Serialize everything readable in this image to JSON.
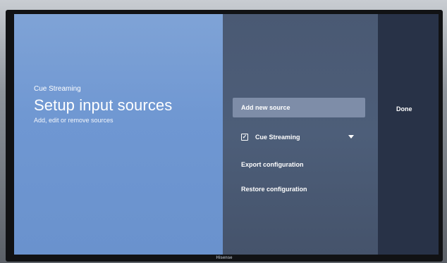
{
  "header": {
    "app_name": "Cue Streaming",
    "title": "Setup input sources",
    "description": "Add, edit or remove sources"
  },
  "menu": {
    "items": [
      {
        "label": "Add new source",
        "focused": true
      },
      {
        "label": "Cue Streaming",
        "checked": true,
        "expandable": true
      },
      {
        "label": "Export configuration"
      },
      {
        "label": "Restore configuration"
      }
    ]
  },
  "actions": {
    "done_label": "Done"
  },
  "tv": {
    "brand": "Hisense"
  },
  "icons": {
    "checkbox": "checkbox-checked-icon",
    "dropdown": "caret-down-icon"
  },
  "colors": {
    "left_panel": "#6f97d2",
    "mid_panel": "#4d5e79",
    "right_panel": "#283247",
    "focus_highlight": "#7e8da8"
  }
}
